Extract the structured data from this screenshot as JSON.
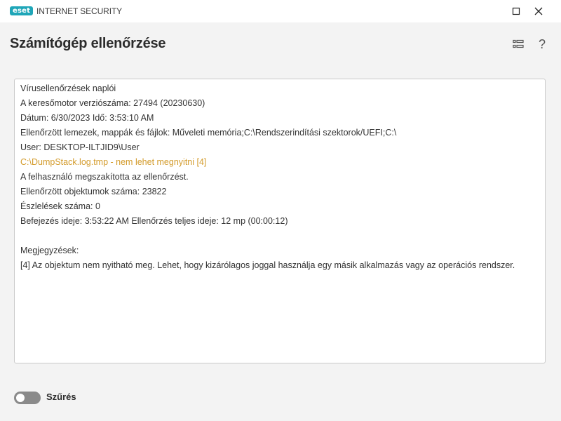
{
  "window": {
    "logo_text": "eset",
    "product_name": "INTERNET SECURITY",
    "minimize_icon": "maximize-icon",
    "close_icon": "close-icon"
  },
  "header": {
    "title": "Számítógép ellenőrzése",
    "list_icon": "list-view-icon",
    "help_symbol": "?"
  },
  "log": {
    "lines": [
      {
        "text": "Vírusellenőrzések naplói",
        "type": "normal"
      },
      {
        "text": "A keresőmotor verziószáma: 27494 (20230630)",
        "type": "normal"
      },
      {
        "text": "Dátum: 6/30/2023   Idő: 3:53:10 AM",
        "type": "normal"
      },
      {
        "text": "Ellenőrzött lemezek, mappák és fájlok: Műveleti memória;C:\\Rendszerindítási szektorok/UEFI;C:\\",
        "type": "normal"
      },
      {
        "text": "User: DESKTOP-ILTJID9\\User",
        "type": "normal"
      },
      {
        "text": "C:\\DumpStack.log.tmp - nem lehet megnyitni [4]",
        "type": "warn"
      },
      {
        "text": "A felhasználó megszakította az ellenőrzést.",
        "type": "normal"
      },
      {
        "text": "Ellenőrzött objektumok száma: 23822",
        "type": "normal"
      },
      {
        "text": "Észlelések száma: 0",
        "type": "normal"
      },
      {
        "text": "Befejezés ideje: 3:53:22 AM  Ellenőrzés teljes ideje: 12 mp (00:00:12)",
        "type": "normal"
      },
      {
        "text": "",
        "type": "blank"
      },
      {
        "text": "Megjegyzések:",
        "type": "normal"
      },
      {
        "text": "[4] Az objektum nem nyitható meg. Lehet, hogy kizárólagos joggal használja egy másik alkalmazás vagy az operációs rendszer.",
        "type": "normal"
      }
    ]
  },
  "filter": {
    "label": "Szűrés",
    "enabled": false
  },
  "colors": {
    "brand": "#1fa6b8",
    "warning_text": "#d39b2b",
    "toggle_off": "#8a8a8a"
  }
}
